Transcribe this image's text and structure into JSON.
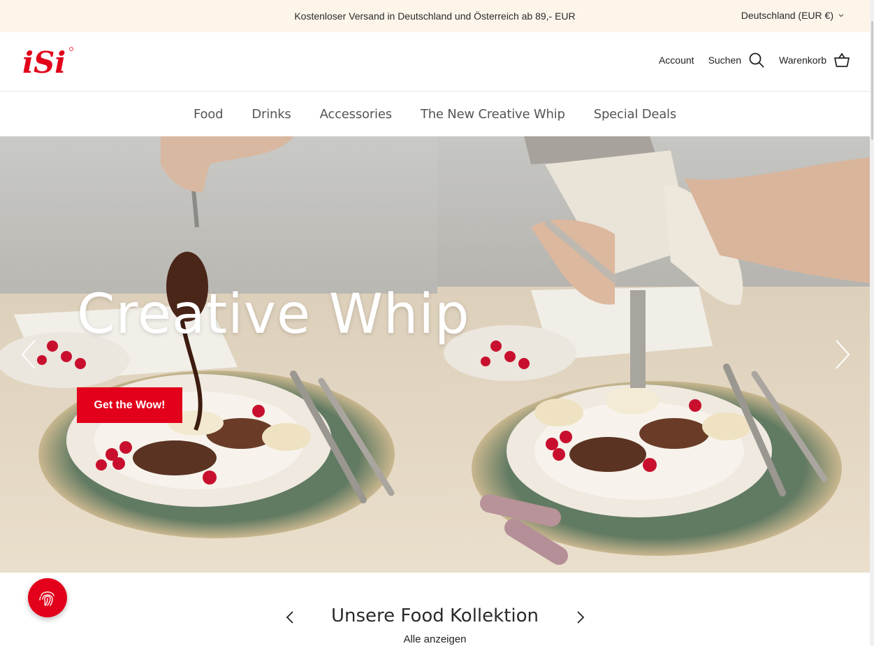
{
  "announcement": {
    "text": "Kostenloser Versand in Deutschland und Österreich ab 89,- EUR"
  },
  "region": {
    "label": "Deutschland (EUR €)"
  },
  "brand": {
    "name": "iSi",
    "color": "#e2001a"
  },
  "header": {
    "account_label": "Account",
    "search_label": "Suchen",
    "cart_label": "Warenkorb"
  },
  "nav": {
    "items": [
      {
        "label": "Food"
      },
      {
        "label": "Drinks"
      },
      {
        "label": "Accessories"
      },
      {
        "label": "The New Creative Whip"
      },
      {
        "label": "Special Deals"
      }
    ]
  },
  "hero": {
    "title": "Creative Whip",
    "cta_label": "Get the Wow!",
    "cta_color": "#e2001a"
  },
  "collection": {
    "title": "Unsere Food Kollektion",
    "view_all_label": "Alle anzeigen"
  },
  "icons": [
    "chevron-down-icon",
    "search-icon",
    "cart-icon",
    "chevron-left-icon",
    "chevron-right-icon",
    "fingerprint-icon"
  ]
}
